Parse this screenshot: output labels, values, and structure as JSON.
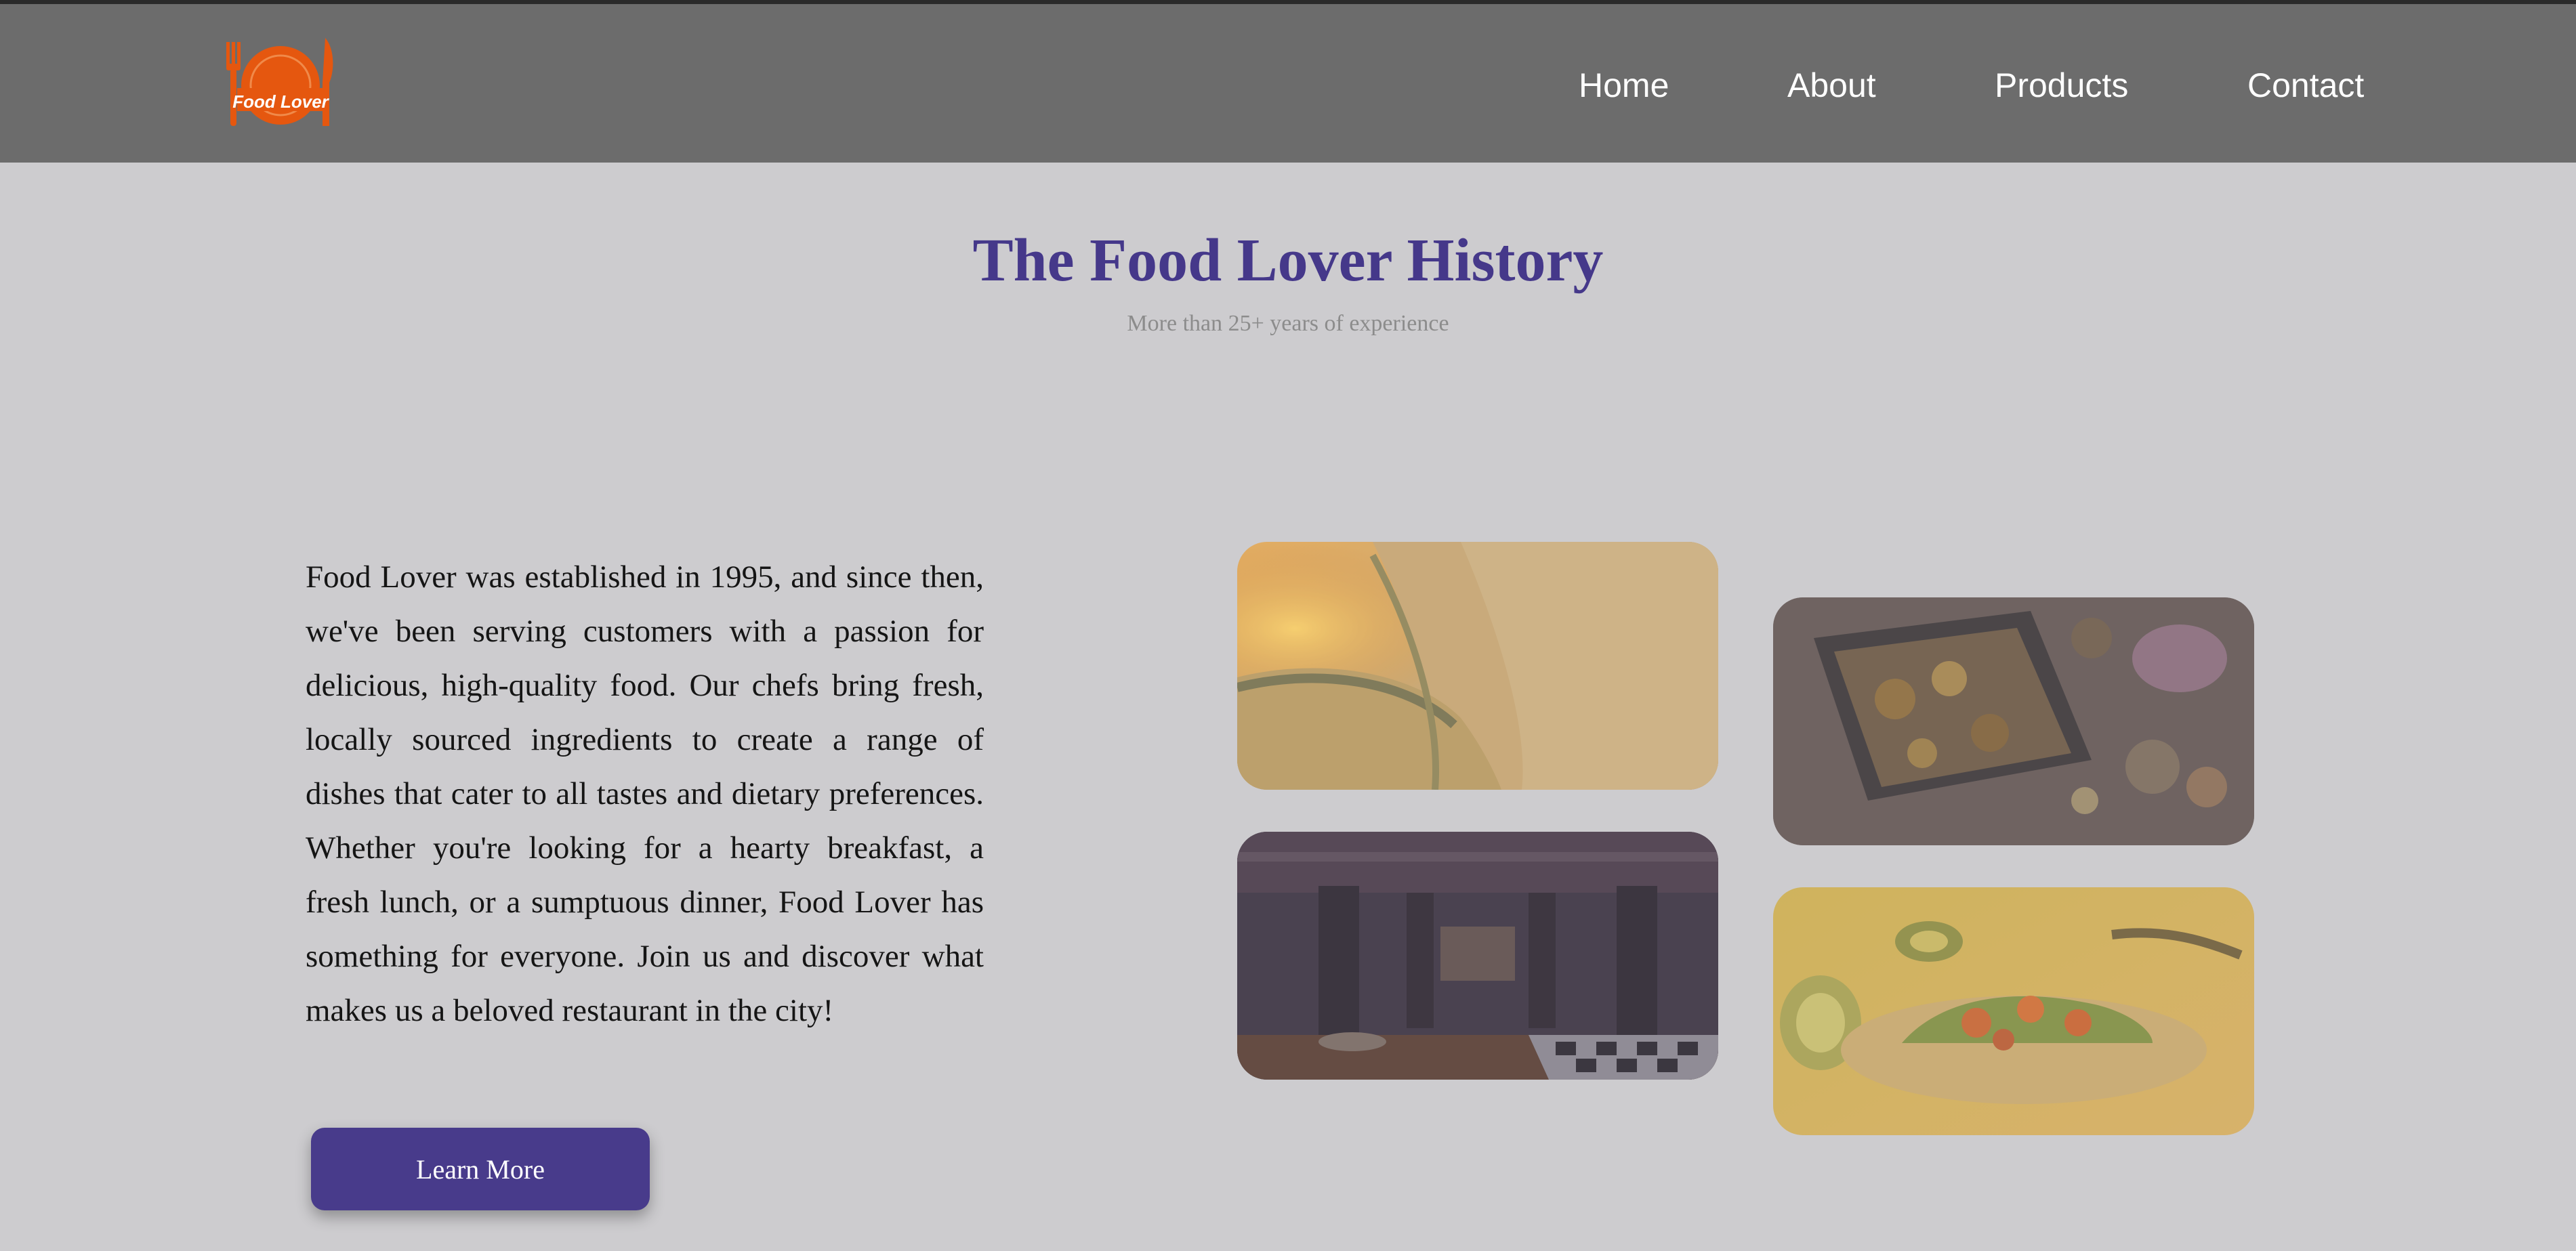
{
  "logo": {
    "text": "Food Lover",
    "color": "#e5570f"
  },
  "nav": {
    "items": [
      {
        "label": "Home"
      },
      {
        "label": "About"
      },
      {
        "label": "Products"
      },
      {
        "label": "Contact"
      }
    ]
  },
  "hero": {
    "title": "The Food Lover History",
    "subtitle": "More than 25+ years of experience"
  },
  "history": {
    "paragraph": "Food Lover was established in 1995, and since then, we've been serving customers with a passion for delicious, high-quality food. Our chefs bring fresh, locally sourced ingredients to create a range of dishes that cater to all tastes and dietary preferences. Whether you're looking for a hearty breakfast, a fresh lunch, or a sumptuous dinner, Food Lover has something for everyone. Join us and discover what makes us a beloved restaurant in the city!",
    "button_label": "Learn More"
  },
  "colors": {
    "accent": "#483b8b",
    "title": "#45388a",
    "navbar": "#6c6c6c",
    "background": "#cdcccf"
  }
}
